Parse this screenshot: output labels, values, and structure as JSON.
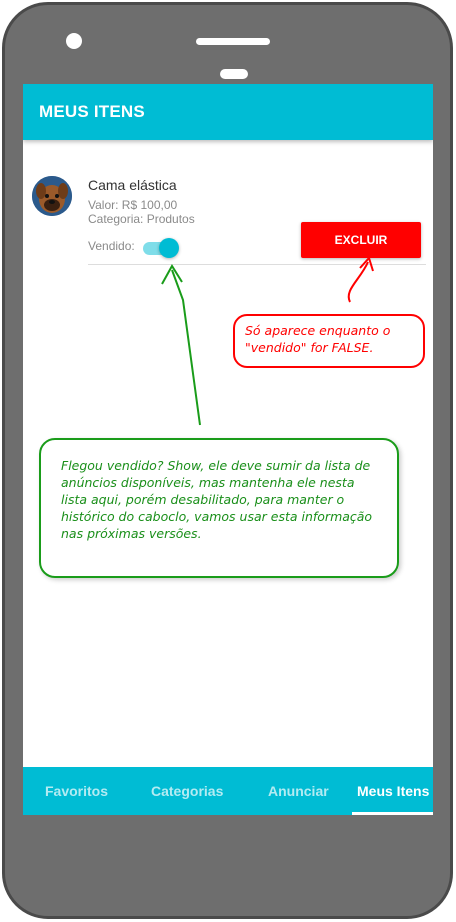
{
  "app": {
    "title": "MEUS ITENS"
  },
  "item": {
    "title": "Cama elástica",
    "price": "Valor: R$ 100,00",
    "category": "Categoria: Produtos",
    "sold_label": "Vendido:",
    "sold": true,
    "delete_label": "EXCLUIR",
    "avatar_icon": "dog-avatar-icon"
  },
  "tabs": [
    {
      "label": "Favoritos",
      "active": false
    },
    {
      "label": "Categorias",
      "active": false
    },
    {
      "label": "Anunciar",
      "active": false
    },
    {
      "label": "Meus Itens",
      "active": true
    }
  ],
  "annotations": {
    "red_note": "Só aparece enquanto o \"vendido\" for FALSE.",
    "green_note": "Flegou vendido? Show, ele deve sumir da lista de anúncios disponíveis, mas mantenha ele nesta lista aqui, porém desabilitado, para manter o histórico do caboclo, vamos usar esta informação nas próximas versões."
  },
  "colors": {
    "accent": "#00bcd4",
    "danger": "#ff0000",
    "annotation_green": "#1a9c1a"
  }
}
